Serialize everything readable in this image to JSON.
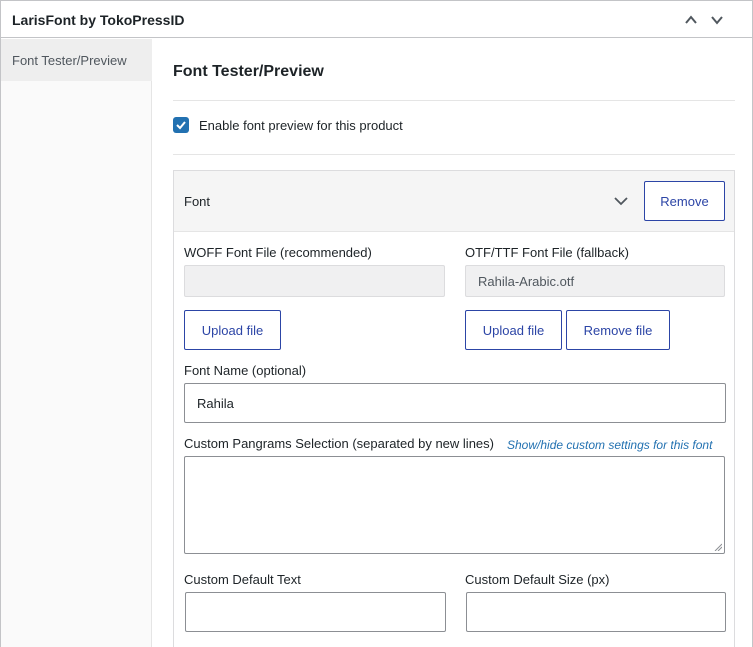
{
  "metabox": {
    "title": "LarisFont by TokoPressID",
    "icons": {
      "move_up": "chevron-up-icon",
      "move_down": "chevron-down-icon"
    }
  },
  "sidebar": {
    "items": [
      {
        "label": "Font Tester/Preview",
        "active": true
      }
    ]
  },
  "panel": {
    "title": "Font Tester/Preview",
    "enable_preview": {
      "label": "Enable font preview for this product",
      "checked": true
    },
    "font": {
      "header_label": "Font",
      "remove_label": "Remove",
      "woff": {
        "label": "WOFF Font File (recommended)",
        "value": "",
        "upload_label": "Upload file"
      },
      "otf": {
        "label": "OTF/TTF Font File (fallback)",
        "value": "Rahila-Arabic.otf",
        "upload_label": "Upload file",
        "remove_label": "Remove file"
      },
      "font_name": {
        "label": "Font Name (optional)",
        "value": "Rahila"
      },
      "pangrams": {
        "label": "Custom Pangrams Selection (separated by new lines)",
        "value": "",
        "toggle_link": "Show/hide custom settings for this font"
      },
      "default_text": {
        "label": "Custom Default Text",
        "value": ""
      },
      "default_size": {
        "label": "Custom Default Size (px)",
        "value": ""
      }
    }
  },
  "colors": {
    "accent": "#2c45a6",
    "checkbox": "#2271b1",
    "link": "#2271b1",
    "border": "#c3c4c7"
  }
}
